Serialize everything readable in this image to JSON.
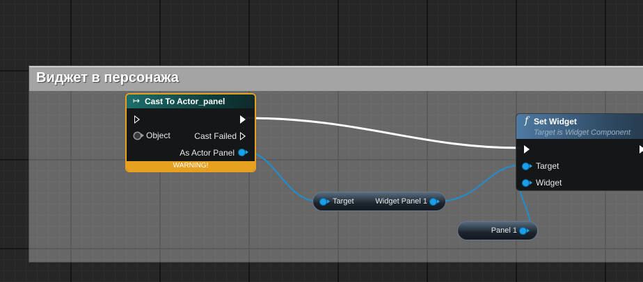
{
  "comment": {
    "title": "Виджет в персонажа"
  },
  "cast_node": {
    "title": "Cast To Actor_panel",
    "pins": {
      "object": "Object",
      "cast_failed": "Cast Failed",
      "as_actor": "As Actor Panel"
    },
    "warning": "WARNING!",
    "icon": "cast-arrow-icon",
    "accent": "#e8a020"
  },
  "set_widget_node": {
    "title": "Set Widget",
    "subtitle": "Target is Widget Component",
    "pins": {
      "target": "Target",
      "widget": "Widget"
    },
    "icon": "function-icon"
  },
  "widget_panel_node": {
    "target_label": "Target",
    "output_label": "Widget Panel 1"
  },
  "panel_node": {
    "label": "Panel 1"
  },
  "colors": {
    "object_pin": "#1aa0e8",
    "exec_wire": "#ffffff",
    "grid_bg": "#262626"
  }
}
